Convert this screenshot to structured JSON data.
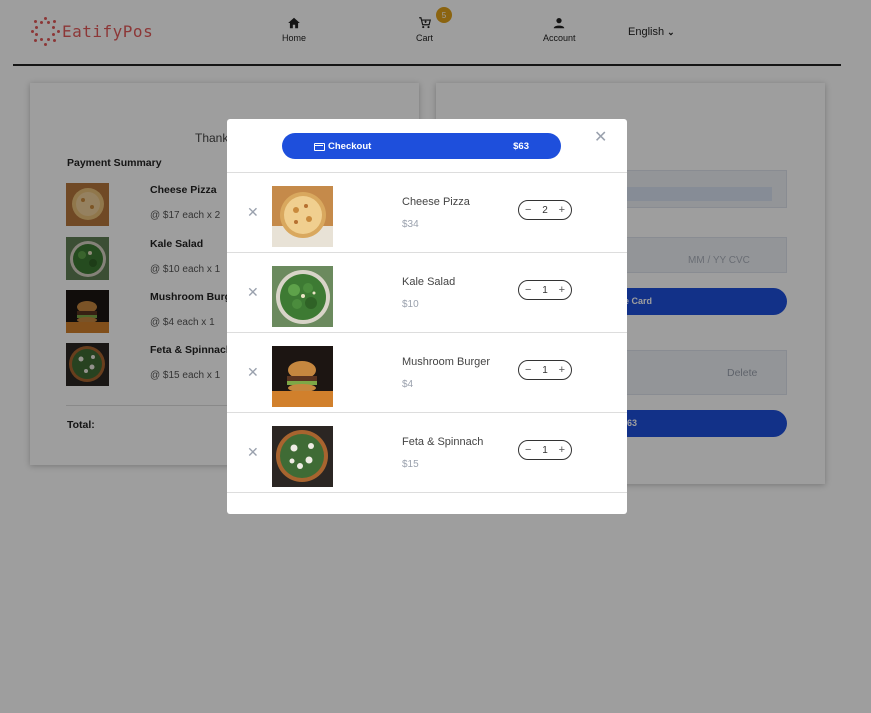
{
  "header": {
    "logo_text": "EatifyPos",
    "nav": [
      {
        "label": "Home",
        "icon": "home-icon"
      },
      {
        "label": "Cart",
        "icon": "cart-icon",
        "badge": "5"
      },
      {
        "label": "Account",
        "icon": "user-icon"
      }
    ],
    "language": "English"
  },
  "left_card": {
    "thanks_text": "Thank",
    "payment_summary_label": "Payment Summary",
    "items": [
      {
        "name": "Cheese Pizza",
        "detail": "@ $17 each x 2"
      },
      {
        "name": "Kale Salad",
        "detail": "@ $10 each x 1"
      },
      {
        "name": "Mushroom Burg",
        "detail": "@ $4 each x 1"
      },
      {
        "name": "Feta & Spinnach",
        "detail": "@ $15 each x 1"
      }
    ],
    "total_label": "Total:"
  },
  "right_card": {
    "card_expiry_placeholder": "MM / YY  CVC",
    "save_card_label": "e Card",
    "delete_label": "Delete",
    "pay_label": "$63"
  },
  "modal": {
    "checkout_label": "Checkout",
    "checkout_total": "$63",
    "items": [
      {
        "name": "Cheese Pizza",
        "price": "$34",
        "qty": "2"
      },
      {
        "name": "Kale Salad",
        "price": "$10",
        "qty": "1"
      },
      {
        "name": "Mushroom Burger",
        "price": "$4",
        "qty": "1"
      },
      {
        "name": "Feta & Spinnach",
        "price": "$15",
        "qty": "1"
      }
    ]
  },
  "colors": {
    "primary": "#1e4fdc",
    "brand": "#e35a5a",
    "badge": "#e0a21a"
  }
}
